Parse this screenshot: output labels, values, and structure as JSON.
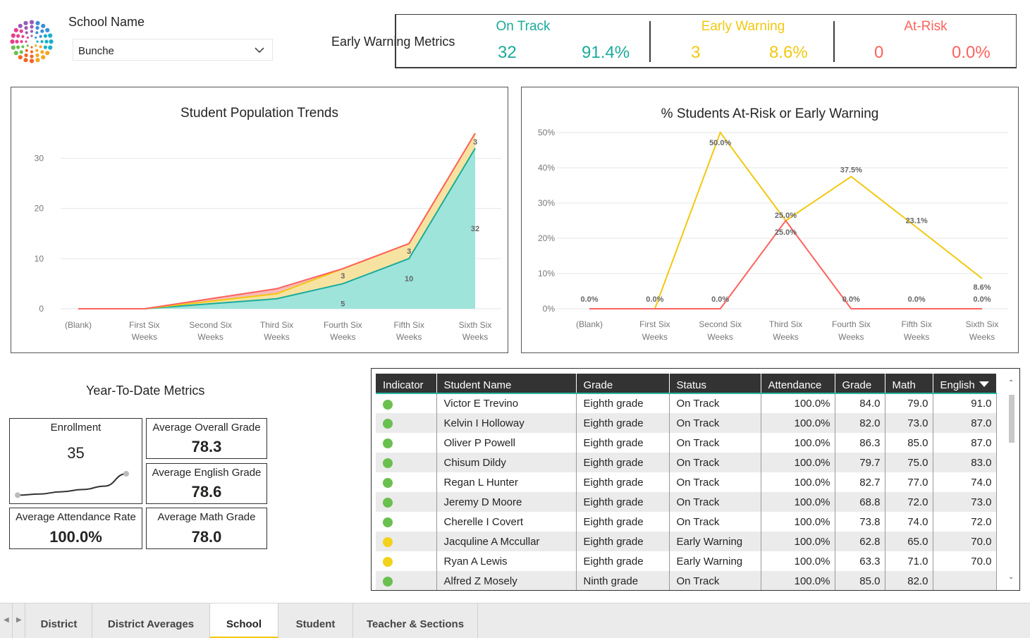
{
  "header": {
    "school_label": "School Name",
    "school_selected": "Bunche",
    "metrics_title": "Early Warning Metrics"
  },
  "metrics": {
    "on_track": {
      "title": "On Track",
      "count": "32",
      "percent": "91.4%",
      "color": "#1aab9b"
    },
    "early_warning": {
      "title": "Early Warning",
      "count": "3",
      "percent": "8.6%",
      "color": "#f2c811"
    },
    "at_risk": {
      "title": "At-Risk",
      "count": "0",
      "percent": "0.0%",
      "color": "#fd625e"
    }
  },
  "chart_data": [
    {
      "type": "area",
      "title": "Student Population Trends",
      "categories": [
        "(Blank)",
        "First Six|Weeks",
        "Second Six|Weeks",
        "Third Six|Weeks",
        "Fourth Six|Weeks",
        "Fifth Six|Weeks",
        "Sixth Six|Weeks"
      ],
      "ylim": [
        0,
        35
      ],
      "yticks": [
        0,
        10,
        20,
        30
      ],
      "stacked": true,
      "series": [
        {
          "key": "on_track",
          "color": "#1aab9b",
          "fill": "#99e3d9",
          "values": [
            0,
            0,
            1,
            2,
            5,
            10,
            32
          ],
          "labels": [
            "",
            "",
            "",
            "",
            "5",
            "10",
            "32"
          ]
        },
        {
          "key": "early_warning",
          "color": "#f2c811",
          "fill": "#f7e29c",
          "values": [
            0,
            0,
            0.5,
            1,
            3,
            3,
            3
          ],
          "labels": [
            "",
            "",
            "",
            "",
            "3",
            "3",
            "3"
          ]
        },
        {
          "key": "at_risk",
          "color": "#fd625e",
          "fill": "#f7b7b5",
          "values": [
            0,
            0,
            0.5,
            1,
            0,
            0,
            0
          ],
          "labels": [
            "",
            "",
            "",
            "",
            "",
            "",
            ""
          ]
        }
      ]
    },
    {
      "type": "line",
      "title": "% Students At-Risk or Early Warning",
      "categories": [
        "(Blank)",
        "First Six|Weeks",
        "Second Six|Weeks",
        "Third Six|Weeks",
        "Fourth Six|Weeks",
        "Fifth Six|Weeks",
        "Sixth Six|Weeks"
      ],
      "ylim": [
        0,
        50
      ],
      "yticks": [
        "0%",
        "10%",
        "20%",
        "30%",
        "40%",
        "50%"
      ],
      "series": [
        {
          "key": "early_warning",
          "color": "#f2c811",
          "values": [
            0,
            0,
            50.0,
            25.0,
            37.5,
            23.1,
            8.6
          ],
          "labels": [
            "0.0%",
            "0.0%",
            "50.0%",
            "25.0%",
            "37.5%",
            "23.1%",
            "8.6%"
          ]
        },
        {
          "key": "at_risk",
          "color": "#fd625e",
          "values": [
            0,
            0,
            0,
            25.0,
            0,
            0,
            0
          ],
          "labels": [
            "",
            "",
            "0.0%",
            "25.0%",
            "0.0%",
            "0.0%",
            "0.0%"
          ]
        }
      ]
    }
  ],
  "ytd": {
    "title": "Year-To-Date Metrics",
    "enrollment": {
      "label": "Enrollment",
      "value": "35",
      "trend": [
        0.05,
        0.1,
        0.2,
        0.3,
        0.45,
        1.0
      ]
    },
    "overall": {
      "label": "Average Overall Grade",
      "value": "78.3"
    },
    "english": {
      "label": "Average English Grade",
      "value": "78.6"
    },
    "attendance": {
      "label": "Average Attendance Rate",
      "value": "100.0%"
    },
    "math": {
      "label": "Average Math Grade",
      "value": "78.0"
    }
  },
  "table": {
    "columns": [
      "Indicator",
      "Student Name",
      "Grade",
      "Status",
      "Attendance",
      "Grade",
      "Math",
      "English"
    ],
    "rows": [
      {
        "indicator": "#6ac04e",
        "name": "Victor E Trevino",
        "grade": "Eighth grade",
        "status": "On Track",
        "attendance": "100.0%",
        "avg": "84.0",
        "math": "79.0",
        "english": "91.0"
      },
      {
        "indicator": "#6ac04e",
        "name": "Kelvin I Holloway",
        "grade": "Eighth grade",
        "status": "On Track",
        "attendance": "100.0%",
        "avg": "82.0",
        "math": "73.0",
        "english": "87.0"
      },
      {
        "indicator": "#6ac04e",
        "name": "Oliver P Powell",
        "grade": "Eighth grade",
        "status": "On Track",
        "attendance": "100.0%",
        "avg": "86.3",
        "math": "85.0",
        "english": "87.0"
      },
      {
        "indicator": "#6ac04e",
        "name": "Chisum Dildy",
        "grade": "Eighth grade",
        "status": "On Track",
        "attendance": "100.0%",
        "avg": "79.7",
        "math": "75.0",
        "english": "83.0"
      },
      {
        "indicator": "#6ac04e",
        "name": "Regan L Hunter",
        "grade": "Eighth grade",
        "status": "On Track",
        "attendance": "100.0%",
        "avg": "82.7",
        "math": "77.0",
        "english": "74.0"
      },
      {
        "indicator": "#6ac04e",
        "name": "Jeremy D Moore",
        "grade": "Eighth grade",
        "status": "On Track",
        "attendance": "100.0%",
        "avg": "68.8",
        "math": "72.0",
        "english": "73.0"
      },
      {
        "indicator": "#6ac04e",
        "name": "Cherelle I Covert",
        "grade": "Eighth grade",
        "status": "On Track",
        "attendance": "100.0%",
        "avg": "73.8",
        "math": "74.0",
        "english": "72.0"
      },
      {
        "indicator": "#f2d21b",
        "name": "Jacquline A Mccullar",
        "grade": "Eighth grade",
        "status": "Early Warning",
        "attendance": "100.0%",
        "avg": "62.8",
        "math": "65.0",
        "english": "70.0"
      },
      {
        "indicator": "#f2d21b",
        "name": "Ryan A Lewis",
        "grade": "Eighth grade",
        "status": "Early Warning",
        "attendance": "100.0%",
        "avg": "63.3",
        "math": "71.0",
        "english": "70.0"
      },
      {
        "indicator": "#6ac04e",
        "name": "Alfred Z Mosely",
        "grade": "Ninth grade",
        "status": "On Track",
        "attendance": "100.0%",
        "avg": "85.0",
        "math": "82.0",
        "english": ""
      }
    ]
  },
  "tabs": [
    {
      "label": "District",
      "active": false
    },
    {
      "label": "District Averages",
      "active": false
    },
    {
      "label": "School",
      "active": true
    },
    {
      "label": "Student",
      "active": false
    },
    {
      "label": "Teacher & Sections",
      "active": false
    }
  ]
}
